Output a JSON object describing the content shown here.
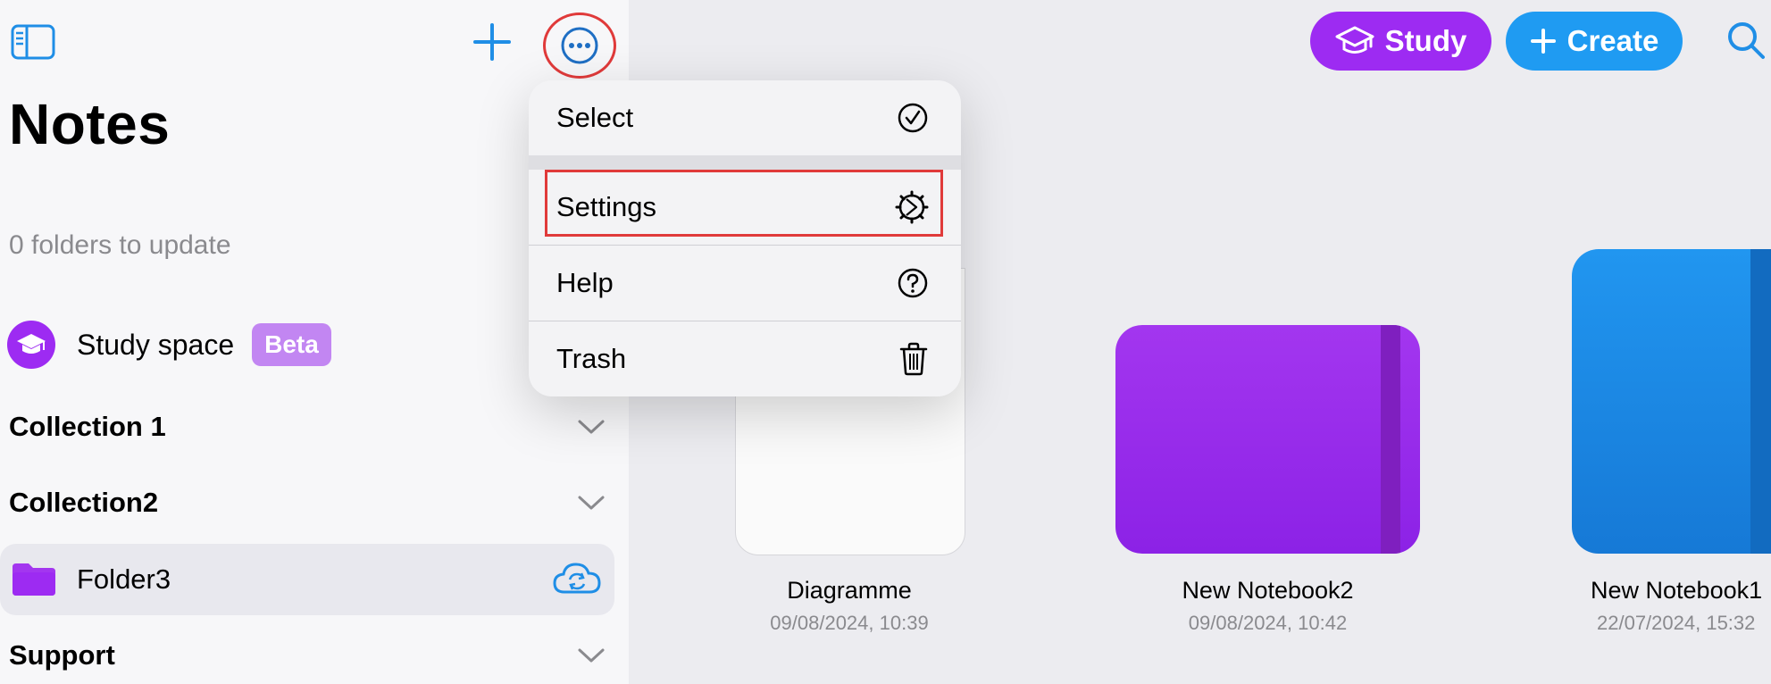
{
  "sidebar": {
    "title": "Notes",
    "status_text": "0 folders to update",
    "study_space": {
      "label": "Study space",
      "badge": "Beta"
    },
    "sections": [
      {
        "label": "Collection 1"
      },
      {
        "label": "Collection2"
      }
    ],
    "folder": {
      "label": "Folder3"
    },
    "support": {
      "label": "Support"
    }
  },
  "toolbar": {
    "study_label": "Study",
    "create_label": "Create"
  },
  "menu": {
    "items": [
      {
        "label": "Select",
        "icon": "checkmark-circle-icon"
      },
      {
        "label": "Settings",
        "icon": "gear-icon"
      },
      {
        "label": "Help",
        "icon": "question-circle-icon"
      },
      {
        "label": "Trash",
        "icon": "trash-icon"
      }
    ]
  },
  "notebooks": [
    {
      "title": "Diagramme",
      "date": "09/08/2024, 10:39",
      "color": "#ffffff"
    },
    {
      "title": "New Notebook2",
      "date": "09/08/2024, 10:42",
      "color": "#9d2bf2"
    },
    {
      "title": "New Notebook1",
      "date": "22/07/2024, 15:32",
      "color": "#1f8ee6"
    }
  ],
  "colors": {
    "accent_purple": "#9d2bf2",
    "accent_blue": "#1f9bf2",
    "highlight_red": "#e03a3a",
    "beta_badge": "#c286f2"
  }
}
